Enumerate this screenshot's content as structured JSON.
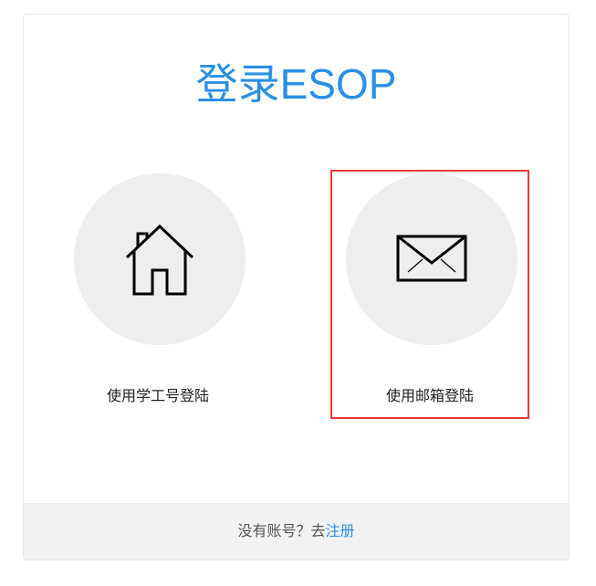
{
  "title": "登录ESOP",
  "options": [
    {
      "label": "使用学工号登陆",
      "icon": "house-icon"
    },
    {
      "label": "使用邮箱登陆",
      "icon": "envelope-icon"
    }
  ],
  "footer": {
    "prompt": "没有账号？去",
    "register_link": "注册"
  },
  "colors": {
    "accent": "#2b8fe6",
    "highlight_border": "#e53935",
    "circle_bg": "#eeeeee",
    "footer_bg": "#f2f2f2"
  }
}
